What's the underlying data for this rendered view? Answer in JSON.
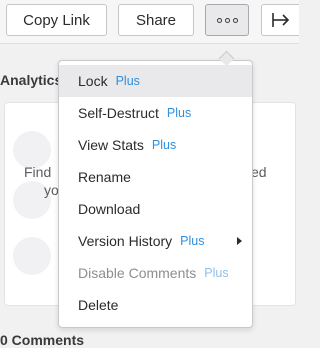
{
  "toolbar": {
    "copy_link_label": "Copy Link",
    "share_label": "Share",
    "more_icon": "more-horizontal-icon",
    "exit_icon": "exit-icon"
  },
  "background": {
    "analytics_label": "Analytics",
    "find_text": "Find",
    "yo_text": "yo",
    "ed_text": "ed",
    "comments_label": "0 Comments"
  },
  "menu": {
    "plus_color": "#2f8fe0",
    "items": [
      {
        "label": "Lock",
        "badge": "Plus"
      },
      {
        "label": "Self-Destruct",
        "badge": "Plus"
      },
      {
        "label": "View Stats",
        "badge": "Plus"
      },
      {
        "label": "Rename"
      },
      {
        "label": "Download"
      },
      {
        "label": "Version History",
        "badge": "Plus"
      },
      {
        "label": "Disable Comments",
        "badge": "Plus"
      },
      {
        "label": "Delete"
      }
    ]
  }
}
